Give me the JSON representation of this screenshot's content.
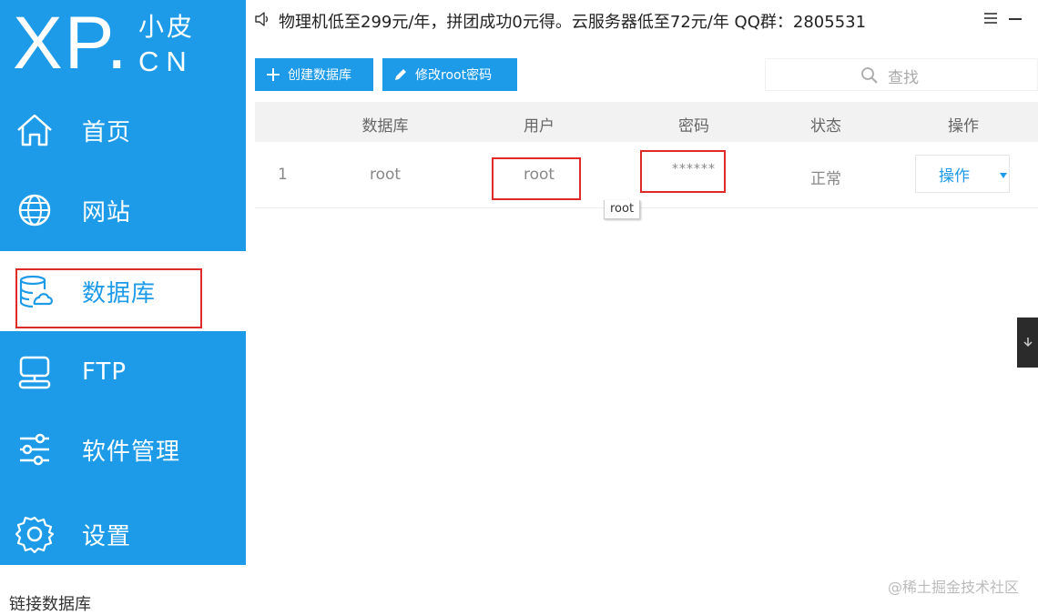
{
  "logo": {
    "brand": "XP.",
    "chinese": "小皮",
    "suffix": "CN"
  },
  "sidebar": {
    "items": [
      {
        "label": "首页",
        "icon": "home-icon"
      },
      {
        "label": "网站",
        "icon": "globe-icon"
      },
      {
        "label": "数据库",
        "icon": "database-icon",
        "active": true
      },
      {
        "label": "FTP",
        "icon": "ftp-icon"
      },
      {
        "label": "软件管理",
        "icon": "sliders-icon"
      },
      {
        "label": "设置",
        "icon": "gear-icon"
      }
    ]
  },
  "topbar": {
    "announcement": "物理机低至299元/年，拼团成功0元得。云服务器低至72元/年 QQ群：2805531"
  },
  "toolbar": {
    "create_label": "创建数据库",
    "change_pwd_label": "修改root密码",
    "search_placeholder": "查找"
  },
  "table": {
    "headers": [
      "数据库",
      "用户",
      "密码",
      "状态",
      "操作"
    ],
    "rows": [
      {
        "index": "1",
        "database": "root",
        "user": "root",
        "password": "******",
        "status": "正常",
        "action": "操作"
      }
    ]
  },
  "tooltip": {
    "text": "root"
  },
  "watermark": "@稀土掘金技术社区",
  "bottom_text": "链接数据库",
  "colors": {
    "accent": "#1e9be8",
    "annotation": "#e02a2a"
  }
}
